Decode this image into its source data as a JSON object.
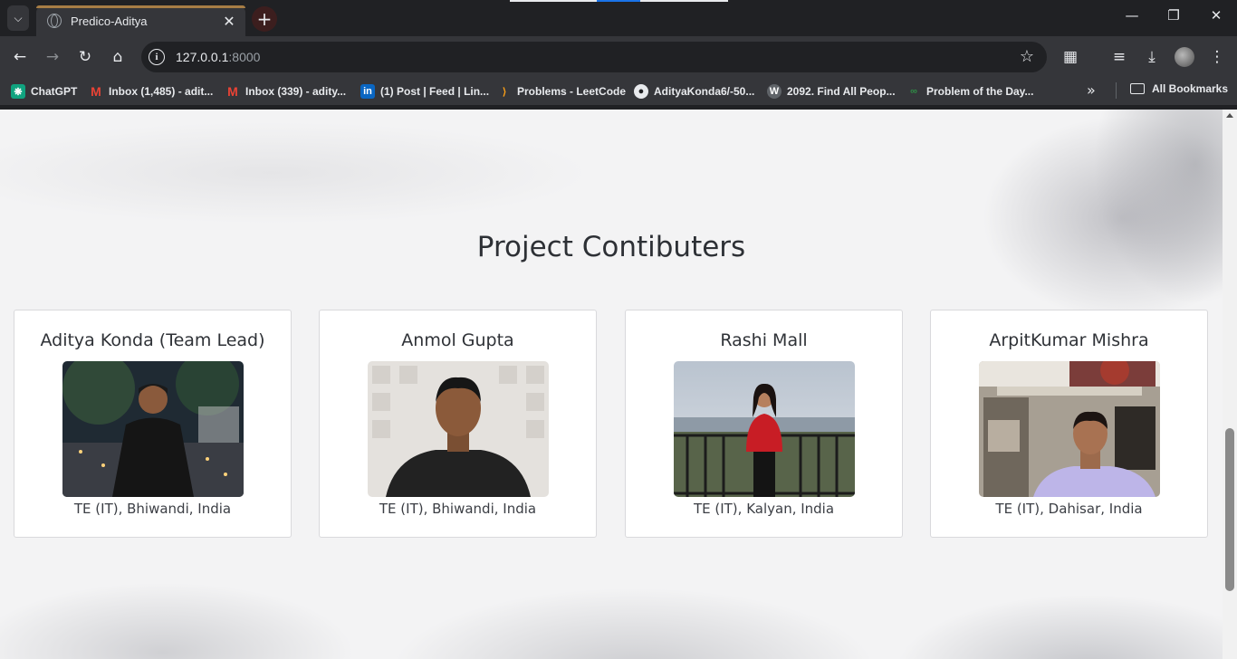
{
  "browser": {
    "tab_title": "Predico-Aditya",
    "url_host": "127.0.0.1",
    "url_port": ":8000",
    "bookmarks": [
      {
        "label": "ChatGPT",
        "icon": "chatgpt-icon"
      },
      {
        "label": "Inbox (1,485) - adit...",
        "icon": "gmail-icon"
      },
      {
        "label": "Inbox (339) - adity...",
        "icon": "gmail-icon"
      },
      {
        "label": "(1) Post | Feed | Lin...",
        "icon": "linkedin-icon"
      },
      {
        "label": "Problems - LeetCode",
        "icon": "leetcode-icon"
      },
      {
        "label": "AdityaKonda6/-50...",
        "icon": "github-icon"
      },
      {
        "label": "2092. Find All Peop...",
        "icon": "w-icon"
      },
      {
        "label": "Problem of the Day...",
        "icon": "gfg-icon"
      }
    ],
    "all_bookmarks": "All Bookmarks"
  },
  "page": {
    "section_title": "Project Contibuters",
    "contributors": [
      {
        "name": "Aditya Konda (Team Lead)",
        "location": "TE (IT), Bhiwandi, India"
      },
      {
        "name": "Anmol Gupta",
        "location": "TE (IT), Bhiwandi, India"
      },
      {
        "name": "Rashi Mall",
        "location": "TE (IT), Kalyan, India"
      },
      {
        "name": "ArpitKumar Mishra",
        "location": "TE (IT), Dahisar, India"
      }
    ]
  },
  "colors": {
    "chrome_dark": "#202124",
    "chrome_toolbar": "#35363a",
    "tab_accent": "#a77d45",
    "page_bg": "#f3f3f4",
    "title_text": "#2d3035"
  }
}
